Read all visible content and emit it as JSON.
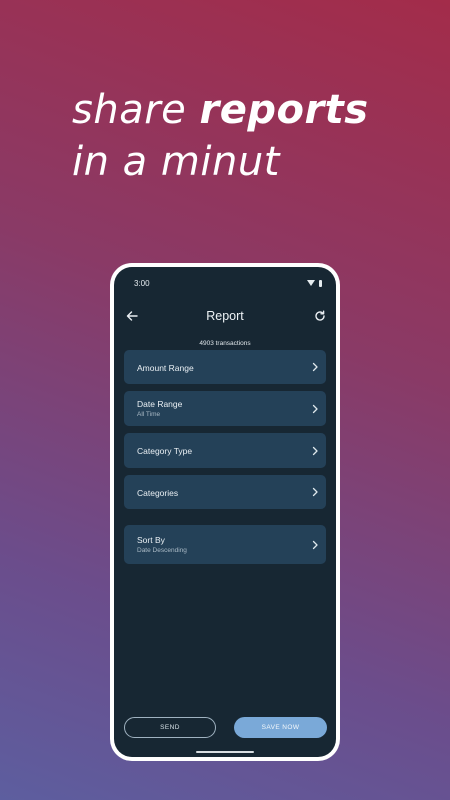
{
  "headline": {
    "line1_light": "share ",
    "line1_bold": "reports",
    "line2": "in a minut"
  },
  "status_bar": {
    "time": "3:00"
  },
  "app_bar": {
    "title": "Report"
  },
  "summary": {
    "transaction_count": "4903 transactions"
  },
  "filters": [
    {
      "label": "Amount Range",
      "value": ""
    },
    {
      "label": "Date Range",
      "value": "All Time"
    },
    {
      "label": "Category Type",
      "value": ""
    },
    {
      "label": "Categories",
      "value": ""
    },
    {
      "label": "Sort By",
      "value": "Date Descending"
    }
  ],
  "actions": {
    "send": "SEND",
    "save": "SAVE NOW"
  },
  "colors": {
    "background_top": "#a32c4a",
    "background_bottom": "#5d5e9f",
    "screen": "#172733",
    "card": "#244158",
    "accent": "#7aa9d8"
  },
  "icons": {
    "back": "arrow-left-icon",
    "refresh": "refresh-icon",
    "chevron": "chevron-right-icon"
  }
}
